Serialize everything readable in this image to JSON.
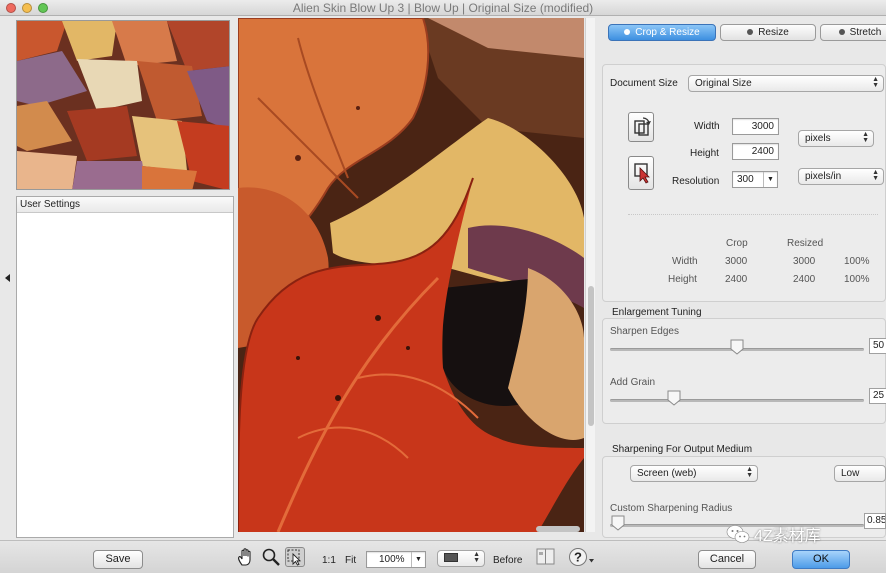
{
  "window": {
    "title": "Alien Skin Blow Up 3 | Blow Up | Original Size (modified)"
  },
  "left": {
    "user_settings_header": "User Settings"
  },
  "tabs": [
    {
      "label": "Crop & Resize",
      "active": true
    },
    {
      "label": "Resize",
      "active": false
    },
    {
      "label": "Stretch",
      "active": false
    }
  ],
  "document": {
    "size_label": "Document Size",
    "size_value": "Original Size",
    "width_label": "Width",
    "width_value": "3000",
    "height_label": "Height",
    "height_value": "2400",
    "unit_value": "pixels",
    "resolution_label": "Resolution",
    "resolution_value": "300",
    "resolution_unit": "pixels/in"
  },
  "summary": {
    "crop_header": "Crop",
    "resized_header": "Resized",
    "rows": [
      {
        "label": "Width",
        "crop": "3000",
        "resized": "3000",
        "percent": "100%"
      },
      {
        "label": "Height",
        "crop": "2400",
        "resized": "2400",
        "percent": "100%"
      }
    ]
  },
  "enlargement": {
    "title": "Enlargement Tuning",
    "sharpen_label": "Sharpen Edges",
    "sharpen_value": "50",
    "sharpen_level": 0.5,
    "grain_label": "Add Grain",
    "grain_value": "25",
    "grain_level": 0.25
  },
  "sharpening": {
    "title": "Sharpening For Output Medium",
    "medium_value": "Screen (web)",
    "amount_value": "Low",
    "radius_label": "Custom Sharpening Radius",
    "radius_value": "0.85",
    "radius_level": 0.03
  },
  "bottom": {
    "save_label": "Save",
    "zoom_1to1": "1:1",
    "zoom_fit": "Fit",
    "zoom_value": "100%",
    "before_label": "Before",
    "help_label": "?",
    "cancel_label": "Cancel",
    "ok_label": "OK"
  },
  "watermark": {
    "text": "4Z素材库"
  },
  "colors": {
    "accent": "#3d8fe0",
    "leaf_red": "#c8361a",
    "leaf_orange": "#d9743b",
    "leaf_yellow": "#e2b766"
  }
}
